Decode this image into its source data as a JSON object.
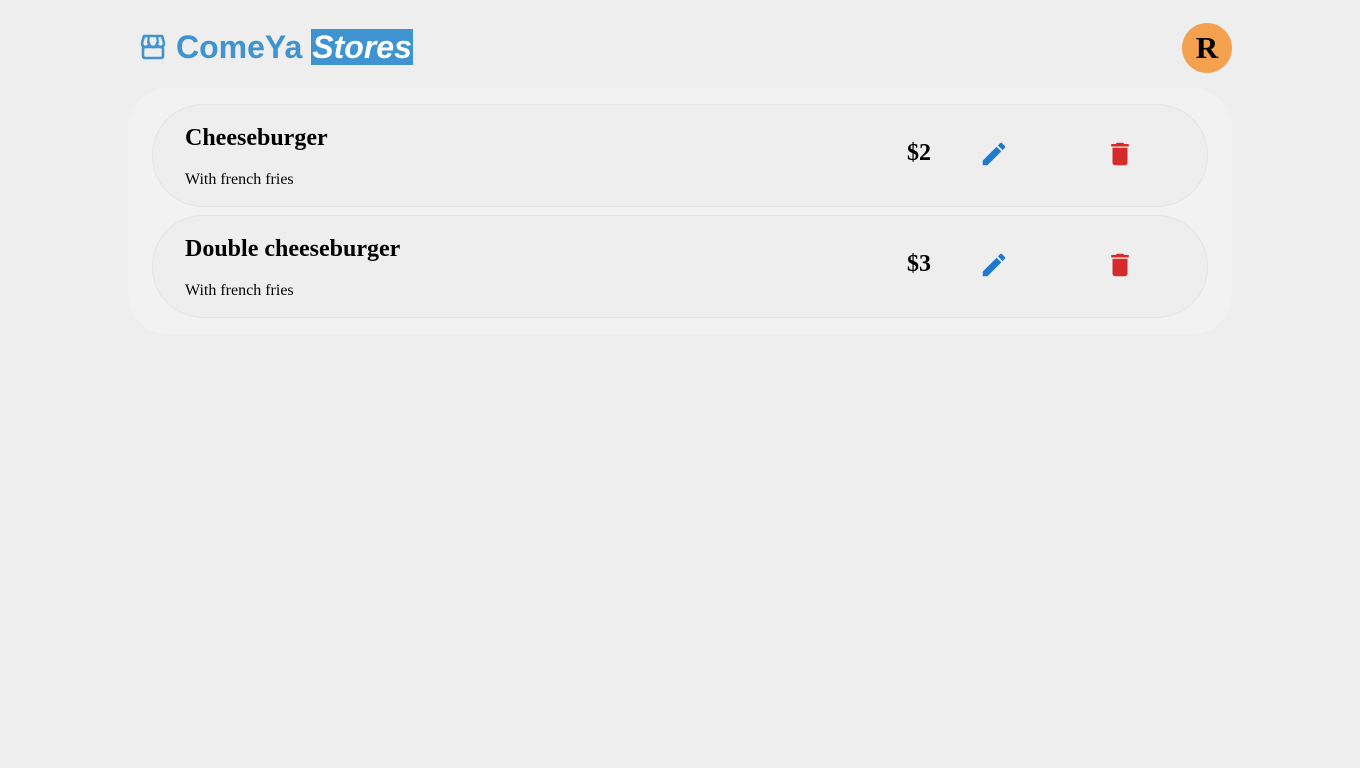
{
  "header": {
    "brand_name": "ComeYa",
    "brand_sub": "Stores",
    "brand_icon": "store-icon",
    "avatar_initial": "R"
  },
  "colors": {
    "brand": "#3f93cf",
    "avatar_bg": "#f3a04f",
    "edit": "#1f78d1",
    "delete": "#d52b2b",
    "background": "#eeeeee"
  },
  "products": [
    {
      "name": "Cheeseburger",
      "description": "With french fries",
      "price": "$2",
      "edit_icon": "pencil-icon",
      "delete_icon": "trash-icon"
    },
    {
      "name": "Double cheeseburger",
      "description": "With french fries",
      "price": "$3",
      "edit_icon": "pencil-icon",
      "delete_icon": "trash-icon"
    }
  ]
}
